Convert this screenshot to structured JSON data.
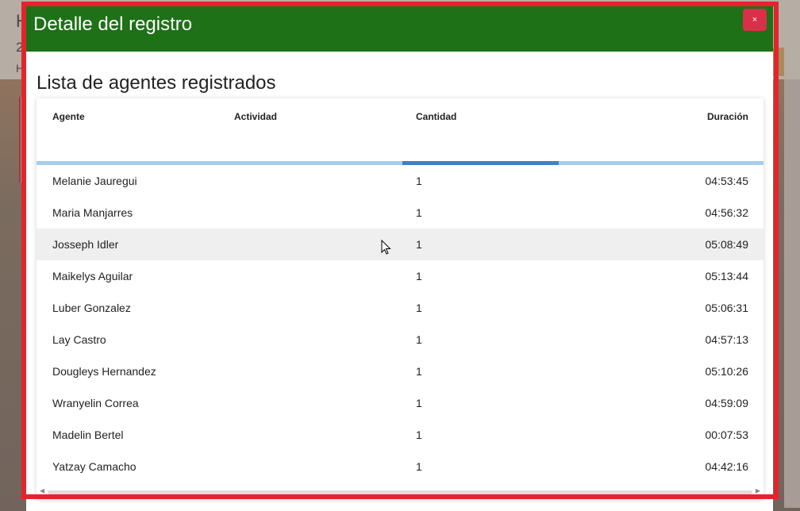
{
  "background": {
    "fragment_1": "H",
    "fragment_2": "2",
    "fragment_3": "H"
  },
  "modal": {
    "title": "Detalle del registro",
    "close_label": "×",
    "list_title": "Lista de agentes registrados",
    "columns": {
      "agente": "Agente",
      "actividad": "Actividad",
      "cantidad": "Cantidad",
      "duracion": "Duración"
    },
    "rows": [
      {
        "agente": "Melanie Jauregui",
        "actividad": "",
        "cantidad": "1",
        "duracion": "04:53:45"
      },
      {
        "agente": "Maria Manjarres",
        "actividad": "",
        "cantidad": "1",
        "duracion": "04:56:32"
      },
      {
        "agente": "Josseph Idler",
        "actividad": "",
        "cantidad": "1",
        "duracion": "05:08:49"
      },
      {
        "agente": "Maikelys Aguilar",
        "actividad": "",
        "cantidad": "1",
        "duracion": "05:13:44"
      },
      {
        "agente": "Luber Gonzalez",
        "actividad": "",
        "cantidad": "1",
        "duracion": "05:06:31"
      },
      {
        "agente": "Lay Castro",
        "actividad": "",
        "cantidad": "1",
        "duracion": "04:57:13"
      },
      {
        "agente": "Dougleys Hernandez",
        "actividad": "",
        "cantidad": "1",
        "duracion": "05:10:26"
      },
      {
        "agente": "Wranyelin Correa",
        "actividad": "",
        "cantidad": "1",
        "duracion": "04:59:09"
      },
      {
        "agente": "Madelin Bertel",
        "actividad": "",
        "cantidad": "1",
        "duracion": "00:07:53"
      },
      {
        "agente": "Yatzay Camacho",
        "actividad": "",
        "cantidad": "1",
        "duracion": "04:42:16"
      }
    ]
  },
  "colors": {
    "header_green": "#1e7116",
    "close_red": "#d9304a",
    "highlight_red": "#e3252b",
    "progress_track": "#a7cdec",
    "progress_bar": "#3d81c9"
  }
}
